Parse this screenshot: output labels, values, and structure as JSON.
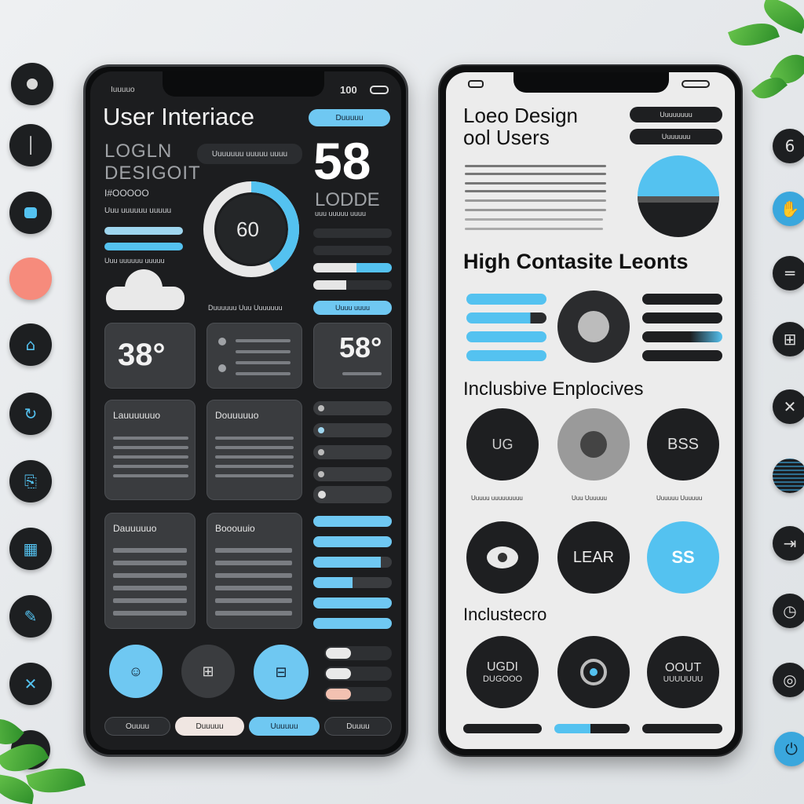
{
  "colors": {
    "accent": "#54c2f0",
    "dark_bg": "#1c1d1f",
    "light_bg": "#ececec",
    "coral": "#f68b7c"
  },
  "left_side_icons": [
    "record-icon",
    "info-icon",
    "chat-icon",
    "coral-circle-icon",
    "lock-icon",
    "refresh-icon",
    "clipboard-icon",
    "grid-icon",
    "edit-icon",
    "close-icon",
    "toggle-icon"
  ],
  "right_side_icons": [
    "number-icon",
    "hand-icon",
    "minus-icon",
    "grid-icon",
    "close-icon",
    "stripes-icon",
    "exit-icon",
    "clock-icon",
    "target-icon",
    "power-icon"
  ],
  "right_side_number": "6",
  "dark_phone": {
    "status_left": "Iuuuuo",
    "status_right": "100",
    "title": "User Interiace",
    "top_pill": "Duuuuu",
    "logo_line1": "LOGLN",
    "logo_line2": "DESIGOIT",
    "logo_sub": "I#OOOOO",
    "logo_caption": "Uuu uuuuuu uuuuu",
    "dropdown": "Uuuuuuu uuuuu uuuu",
    "big_number": "58",
    "big_label": "LODDE",
    "big_caption": "uuu uuuuu uuuu",
    "gauge_value": "60",
    "gauge_fraction": 0.42,
    "cloud_caption": "Duuuuuu Uuu Uuuuuuu",
    "blue_button": "Uuuu uuuu",
    "tiles": [
      {
        "value": "38°"
      },
      {
        "value": ""
      },
      {
        "value": "58°"
      }
    ],
    "mid_cards": [
      "Lauuuuuuo",
      "Douuuuuo"
    ],
    "low_cards": [
      "Dauuuuuo",
      "Booouuio"
    ],
    "bottom_buttons": [
      "Ouuuu",
      "Duuuuu",
      "Uuuuuu",
      "Duuuu"
    ]
  },
  "light_phone": {
    "title_line1": "Loeo Design",
    "title_line2": "ool Users",
    "pill1": "Uuuuuuuu",
    "pill2": "Uuuuuuu",
    "heading1": "High Contasite Leonts",
    "heading2": "Inclusbive Enplocives",
    "heading3": "Inclustecro",
    "row1": [
      {
        "label": "UG",
        "caption": "Uuuuu uuuuuuuuu"
      },
      {
        "label": "",
        "caption": "Uuu Uuuuuu"
      },
      {
        "label": "BSS",
        "caption": "Uuuuuu Uuuuuu"
      }
    ],
    "row2": [
      "",
      "LEAR",
      "SS"
    ],
    "row3": [
      {
        "label": "UGDI",
        "sub": "DUGOOO"
      },
      {
        "label": "",
        "sub": ""
      },
      {
        "label": "OOUT",
        "sub": "UUUUUUU"
      }
    ]
  }
}
